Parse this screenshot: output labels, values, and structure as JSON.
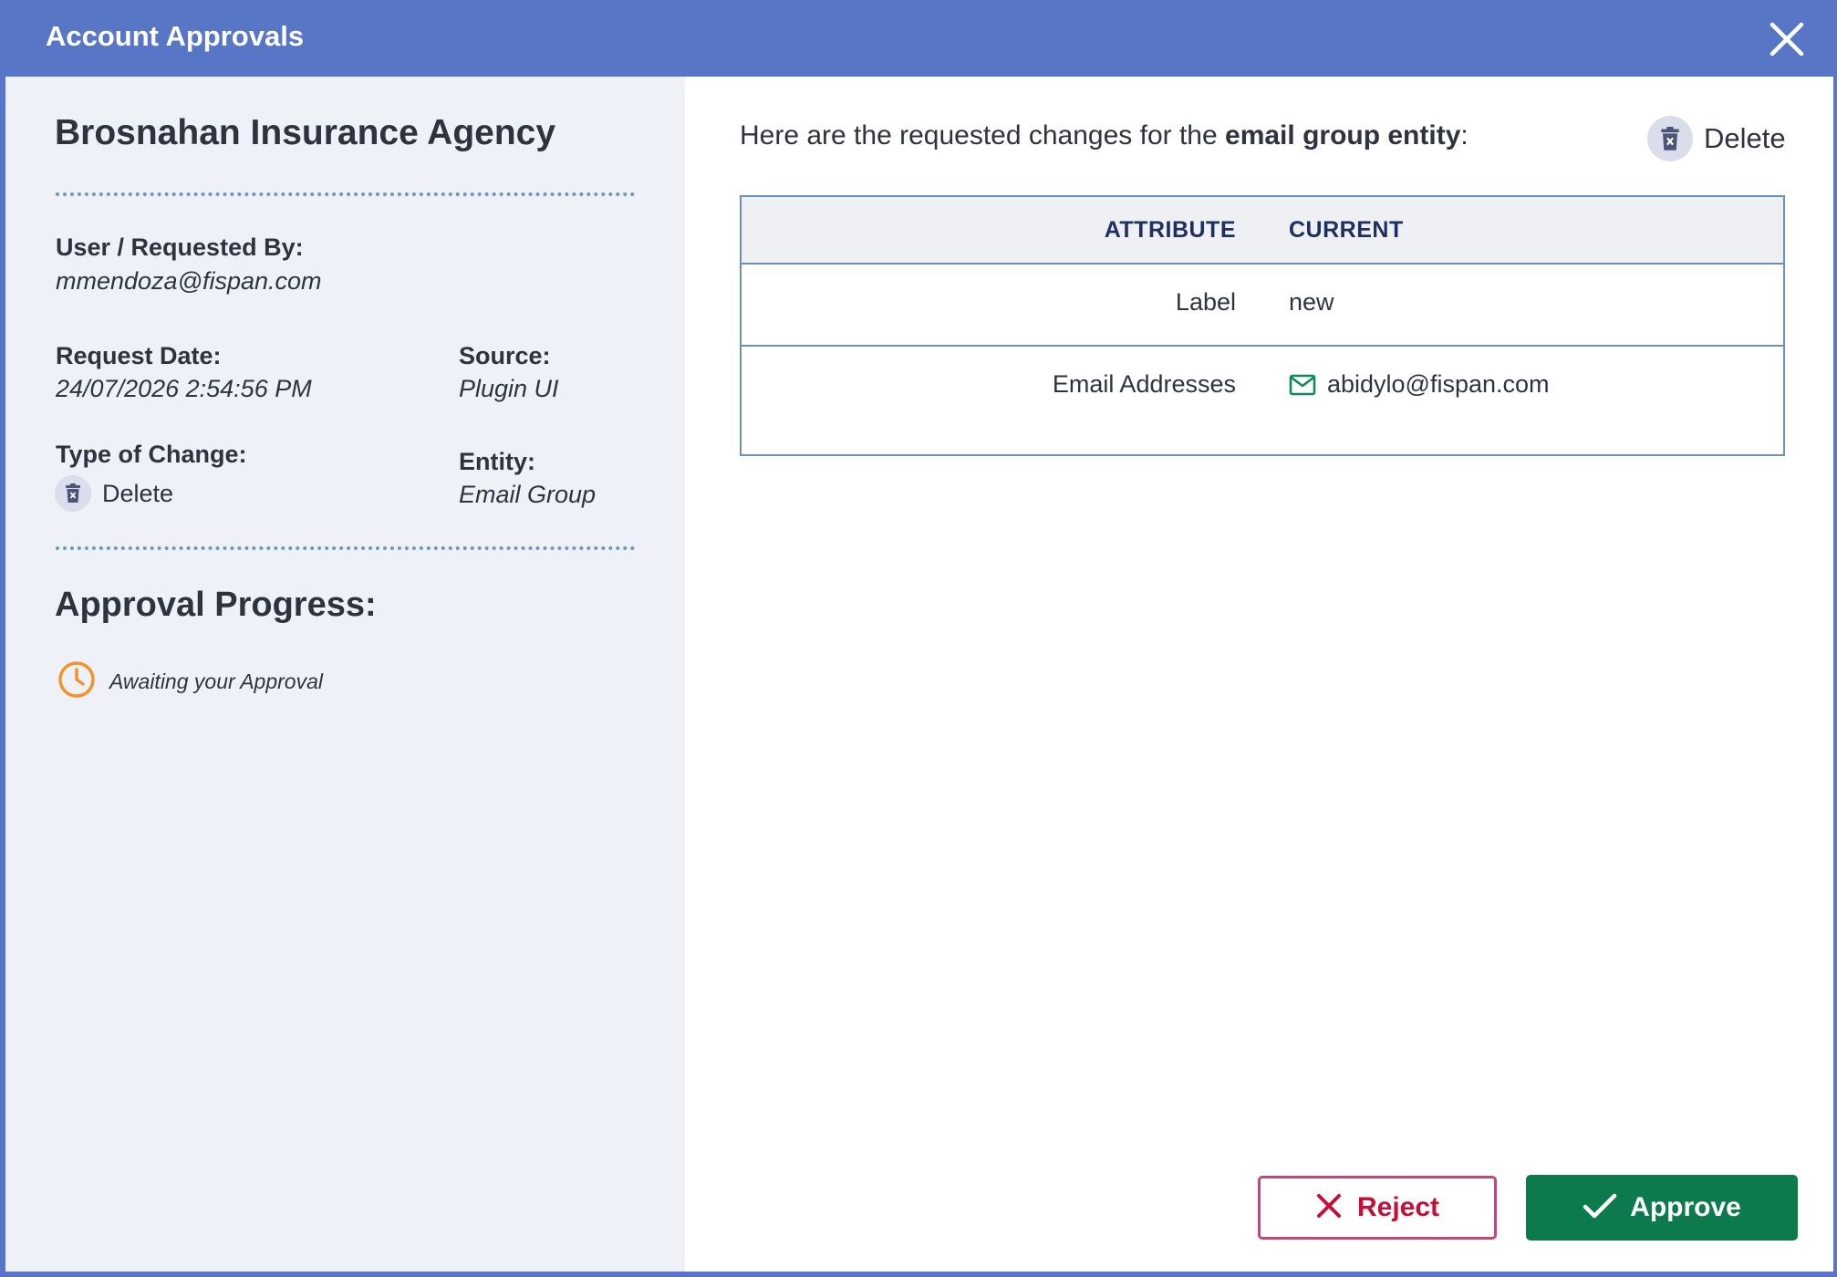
{
  "window": {
    "title": "Account Approvals",
    "close_icon": "close-icon"
  },
  "details": {
    "company": "Brosnahan Insurance Agency",
    "requested_by_label": "User / Requested By:",
    "requested_by": "mmendoza@fispan.com",
    "request_date_label": "Request Date:",
    "request_date": "24/07/2026 2:54:56 PM",
    "source_label": "Source:",
    "source": "Plugin UI",
    "type_label": "Type of Change:",
    "type": "Delete",
    "entity_label": "Entity:",
    "entity": "Email Group"
  },
  "progress": {
    "title": "Approval Progress:",
    "status": "Awaiting your Approval",
    "status_color": "#f0952a"
  },
  "changes": {
    "intro_prefix": "Here are the requested changes for the ",
    "intro_bold": "email group entity",
    "intro_suffix": ":",
    "action_label": "Delete",
    "columns": [
      "ATTRIBUTE",
      "CURRENT"
    ],
    "rows": [
      {
        "attribute": "Label",
        "current": "new",
        "icon": ""
      },
      {
        "attribute": "Email Addresses",
        "current": "abidylo@fispan.com",
        "icon": "mail-icon"
      }
    ]
  },
  "actions": {
    "reject_label": "Reject",
    "approve_label": "Approve",
    "reject_color": "#c3103a",
    "approve_color": "#0d7a4d"
  }
}
